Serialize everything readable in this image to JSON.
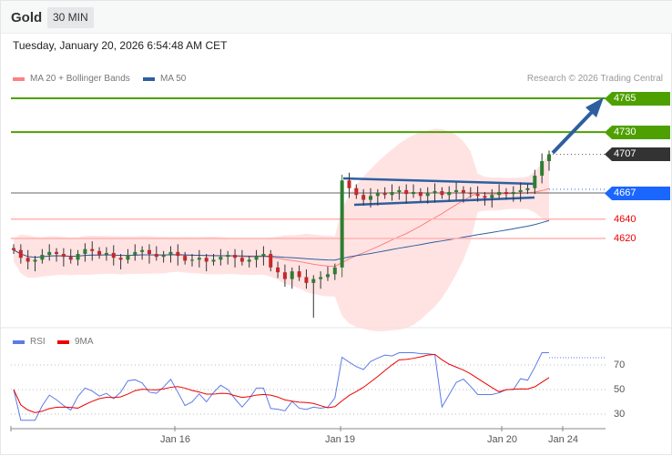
{
  "header": {
    "title": "Gold",
    "timeframe": "30 MIN"
  },
  "timestamp": "Tuesday, January 20, 2026 6:54:48 AM CET",
  "legend": {
    "ma20": "MA 20 + Bollinger Bands",
    "ma50": "MA 50",
    "rsi": "RSI",
    "rsi_ma": "9MA"
  },
  "credit": "Research © 2026 Trading Central",
  "levels": {
    "target2": "4765",
    "target1": "4730",
    "last": "4707",
    "pivot": "4667",
    "support1": "4640",
    "support2": "4620"
  },
  "colors": {
    "green": "#4ea000",
    "pivot": "#1a66ff",
    "last": "#333333",
    "support": "#e00000",
    "ma20": "#ff8080",
    "ma50": "#2d5fa0"
  },
  "rsi_axis": [
    "70",
    "50",
    "30"
  ],
  "x_axis": [
    "Jan 16",
    "Jan 19",
    "Jan 20",
    "Jan 24"
  ],
  "chart_data": {
    "type": "candlestick",
    "ylim": [
      4520,
      4790
    ],
    "closes": [
      4608,
      4600,
      4596,
      4598,
      4603,
      4606,
      4604,
      4601,
      4598,
      4604,
      4609,
      4607,
      4603,
      4605,
      4600,
      4598,
      4603,
      4606,
      4608,
      4604,
      4601,
      4603,
      4606,
      4602,
      4597,
      4598,
      4600,
      4596,
      4598,
      4601,
      4603,
      4600,
      4596,
      4598,
      4602,
      4604,
      4590,
      4585,
      4578,
      4586,
      4580,
      4574,
      4578,
      4580,
      4583,
      4590,
      4680,
      4672,
      4665,
      4660,
      4664,
      4667,
      4665,
      4668,
      4670,
      4666,
      4668,
      4664,
      4667,
      4669,
      4665,
      4668,
      4670,
      4667,
      4666,
      4664,
      4662,
      4665,
      4668,
      4666,
      4668,
      4670,
      4672,
      4685,
      4700,
      4707
    ]
  }
}
